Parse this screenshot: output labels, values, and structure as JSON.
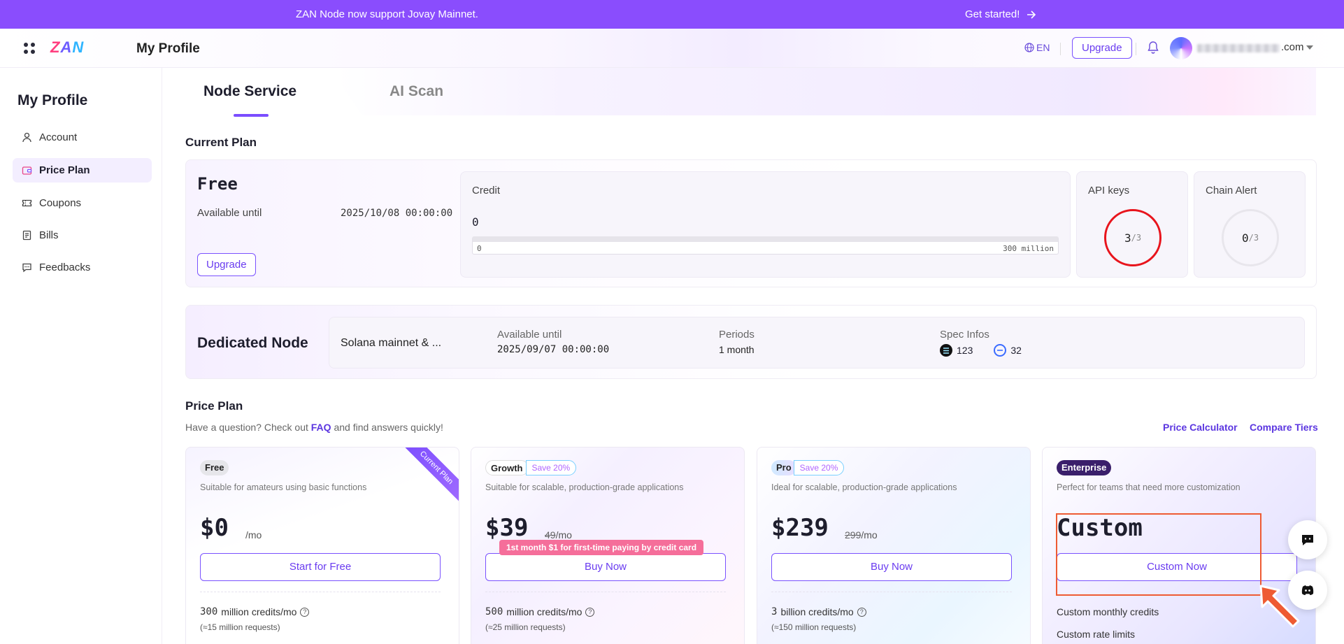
{
  "announcement": {
    "message": "ZAN Node now support Jovay Mainnet.",
    "cta": "Get started!"
  },
  "header": {
    "logo": "ZAN",
    "page_title": "My Profile",
    "language": "EN",
    "upgrade_label": "Upgrade",
    "email_suffix": ".com"
  },
  "sidebar": {
    "title": "My Profile",
    "items": [
      {
        "label": "Account",
        "icon": "user-icon",
        "active": false
      },
      {
        "label": "Price Plan",
        "icon": "wallet-icon",
        "active": true
      },
      {
        "label": "Coupons",
        "icon": "ticket-icon",
        "active": false
      },
      {
        "label": "Bills",
        "icon": "document-icon",
        "active": false
      },
      {
        "label": "Feedbacks",
        "icon": "chat-icon",
        "active": false
      }
    ]
  },
  "tabs": [
    {
      "label": "Node Service",
      "active": true
    },
    {
      "label": "AI Scan",
      "active": false
    }
  ],
  "current_plan": {
    "section_title": "Current Plan",
    "plan_name": "Free",
    "available_label": "Available until",
    "available_date": "2025/10/08 00:00:00",
    "upgrade_label": "Upgrade",
    "credit": {
      "label": "Credit",
      "value": "0",
      "min_label": "0",
      "max_label": "300 million",
      "used_fraction": 0
    },
    "api_keys": {
      "label": "API keys",
      "used": "3",
      "total": "/3"
    },
    "chain_alert": {
      "label": "Chain Alert",
      "used": "0",
      "total": "/3"
    }
  },
  "dedicated_node": {
    "title": "Dedicated Node",
    "chain": "Solana mainnet & ...",
    "available_label": "Available until",
    "available_date": "2025/09/07 00:00:00",
    "periods_label": "Periods",
    "periods_value": "1 month",
    "spec_label": "Spec Infos",
    "spec_a": "123",
    "spec_b": "32"
  },
  "price_plan": {
    "section_title": "Price Plan",
    "sub_prefix": "Have a question? Check out ",
    "faq": "FAQ",
    "sub_suffix": " and find answers quickly!",
    "price_calculator": "Price Calculator",
    "compare_tiers": "Compare Tiers",
    "tiers": [
      {
        "name": "Free",
        "ribbon": "Current Plan",
        "desc": "Suitable for amateurs using basic functions",
        "price": "$0",
        "per": "/mo",
        "button": "Start for Free",
        "credits_num": "300",
        "credits_text": "million credits/mo",
        "requests": "(≈15 million requests)"
      },
      {
        "name": "Growth",
        "save": "Save 20%",
        "desc": "Suitable for scalable, production-grade applications",
        "price": "$39",
        "old_price": "49",
        "per": "/mo",
        "promo": "1st month $1 for first-time paying by credit card",
        "button": "Buy Now",
        "credits_num": "500",
        "credits_text": "million credits/mo",
        "requests": "(≈25 million requests)"
      },
      {
        "name": "Pro",
        "save": "Save 20%",
        "desc": "Ideal for scalable, production-grade applications",
        "price": "$239",
        "old_price": "299",
        "per": "/mo",
        "button": "Buy Now",
        "credits_num": "3",
        "credits_text": "billion credits/mo",
        "requests": "(≈150 million requests)"
      },
      {
        "name": "Enterprise",
        "desc": "Perfect for teams that need more customization",
        "price": "Custom",
        "button": "Custom Now",
        "features": [
          "Custom monthly credits",
          "Custom rate limits"
        ]
      }
    ]
  },
  "colors": {
    "brand": "#8a4dfd",
    "accent": "#7a52ff",
    "highlight": "#ee5b33",
    "alert_ring": "#e8141c"
  }
}
